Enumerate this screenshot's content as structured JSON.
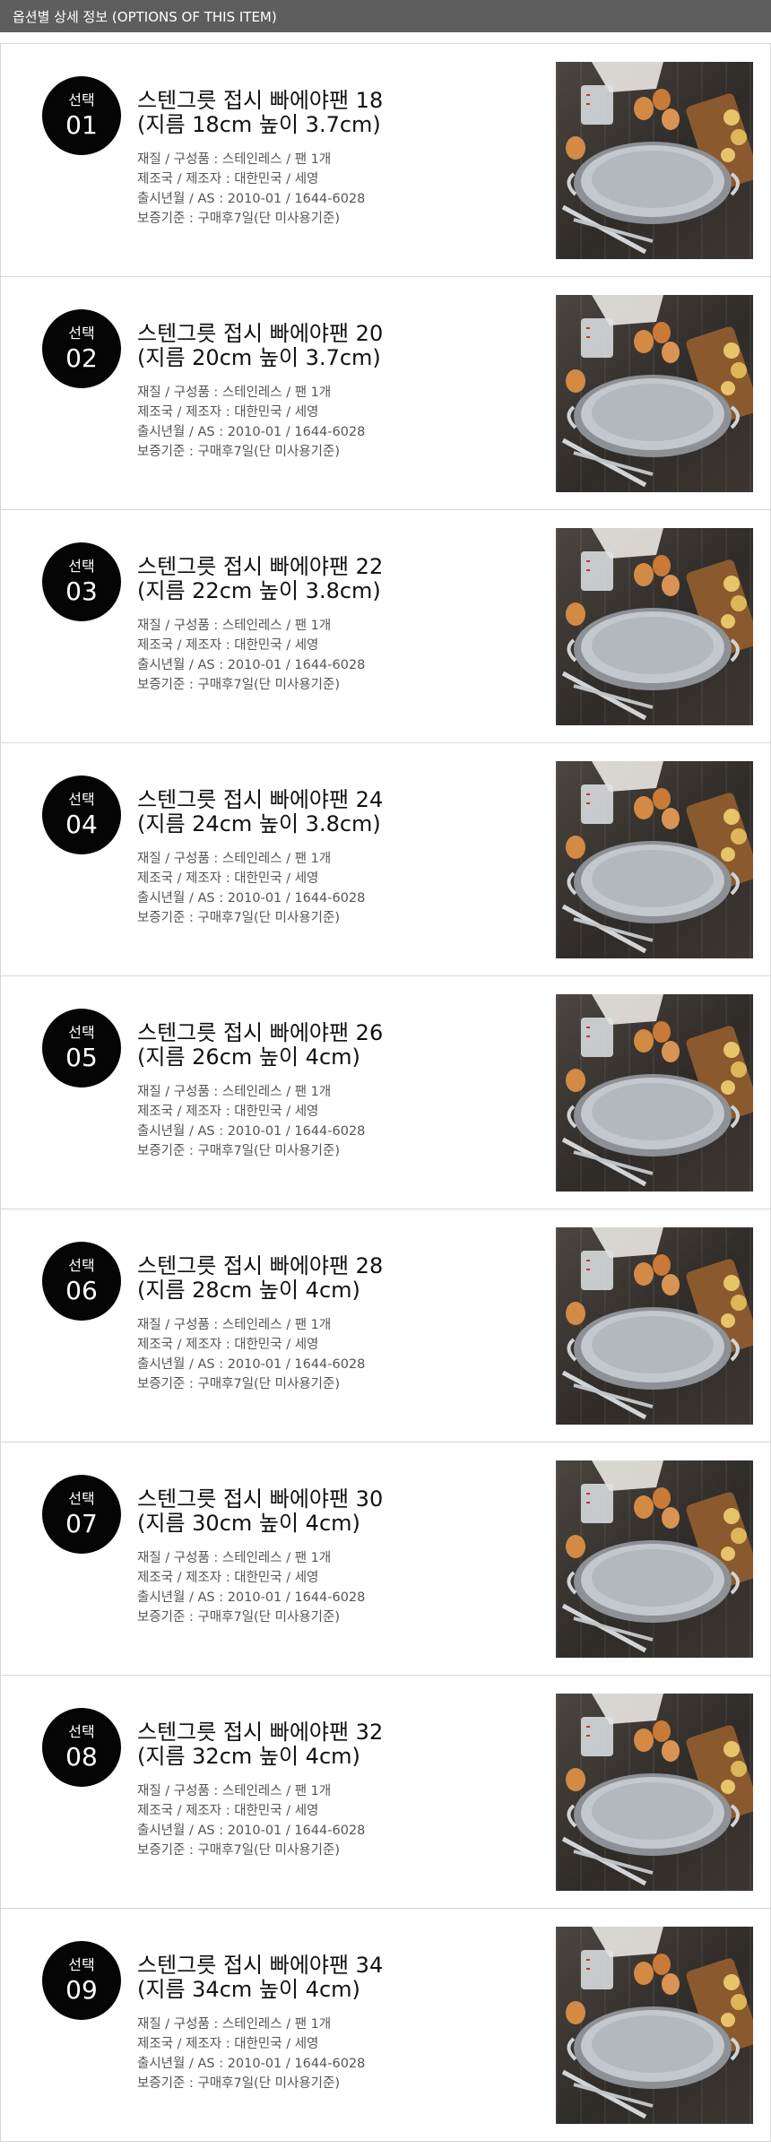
{
  "header": {
    "title": "옵션별 상세 정보 (OPTIONS OF THIS ITEM)"
  },
  "options": [
    {
      "badge_label": "선택",
      "number": "01",
      "title_line1": "스텐그릇 접시 빠에야팬 18",
      "title_line2": "(지름 18cm 높이 3.7cm)",
      "spec1": "재질 / 구성품 : 스테인레스 / 팬 1개",
      "spec2": "제조국 / 제조자 : 대한민국 / 세영",
      "spec3": "출시년월 / AS : 2010-01 / 1644-6028",
      "spec4": "보증기준 : 구매후7일(단 미사용기준)"
    },
    {
      "badge_label": "선택",
      "number": "02",
      "title_line1": "스텐그릇 접시 빠에야팬 20",
      "title_line2": "(지름 20cm 높이 3.7cm)",
      "spec1": "재질 / 구성품 : 스테인레스 / 팬 1개",
      "spec2": "제조국 / 제조자 : 대한민국 / 세영",
      "spec3": "출시년월 / AS : 2010-01 / 1644-6028",
      "spec4": "보증기준 : 구매후7일(단 미사용기준)"
    },
    {
      "badge_label": "선택",
      "number": "03",
      "title_line1": "스텐그릇 접시 빠에야팬 22",
      "title_line2": "(지름 22cm 높이 3.8cm)",
      "spec1": "재질 / 구성품 : 스테인레스 / 팬 1개",
      "spec2": "제조국 / 제조자 : 대한민국 / 세영",
      "spec3": "출시년월 / AS : 2010-01 / 1644-6028",
      "spec4": "보증기준 : 구매후7일(단 미사용기준)"
    },
    {
      "badge_label": "선택",
      "number": "04",
      "title_line1": "스텐그릇 접시 빠에야팬 24",
      "title_line2": "(지름 24cm 높이 3.8cm)",
      "spec1": "재질 / 구성품 : 스테인레스 / 팬 1개",
      "spec2": "제조국 / 제조자 : 대한민국 / 세영",
      "spec3": "출시년월 / AS : 2010-01 / 1644-6028",
      "spec4": "보증기준 : 구매후7일(단 미사용기준)"
    },
    {
      "badge_label": "선택",
      "number": "05",
      "title_line1": "스텐그릇 접시 빠에야팬 26",
      "title_line2": "(지름 26cm 높이 4cm)",
      "spec1": "재질 / 구성품 : 스테인레스 / 팬 1개",
      "spec2": "제조국 / 제조자 : 대한민국 / 세영",
      "spec3": "출시년월 / AS : 2010-01 / 1644-6028",
      "spec4": "보증기준 : 구매후7일(단 미사용기준)"
    },
    {
      "badge_label": "선택",
      "number": "06",
      "title_line1": "스텐그릇 접시 빠에야팬 28",
      "title_line2": "(지름 28cm 높이 4cm)",
      "spec1": "재질 / 구성품 : 스테인레스 / 팬 1개",
      "spec2": "제조국 / 제조자 : 대한민국 / 세영",
      "spec3": "출시년월 / AS : 2010-01 / 1644-6028",
      "spec4": "보증기준 : 구매후7일(단 미사용기준)"
    },
    {
      "badge_label": "선택",
      "number": "07",
      "title_line1": "스텐그릇 접시 빠에야팬 30",
      "title_line2": "(지름 30cm 높이 4cm)",
      "spec1": "재질 / 구성품 : 스테인레스 / 팬 1개",
      "spec2": "제조국 / 제조자 : 대한민국 / 세영",
      "spec3": "출시년월 / AS : 2010-01 / 1644-6028",
      "spec4": "보증기준 : 구매후7일(단 미사용기준)"
    },
    {
      "badge_label": "선택",
      "number": "08",
      "title_line1": "스텐그릇 접시 빠에야팬 32",
      "title_line2": "(지름 32cm 높이 4cm)",
      "spec1": "재질 / 구성품 : 스테인레스 / 팬 1개",
      "spec2": "제조국 / 제조자 : 대한민국 / 세영",
      "spec3": "출시년월 / AS : 2010-01 / 1644-6028",
      "spec4": "보증기준 : 구매후7일(단 미사용기준)"
    },
    {
      "badge_label": "선택",
      "number": "09",
      "title_line1": "스텐그릇 접시 빠에야팬 34",
      "title_line2": "(지름 34cm 높이 4cm)",
      "spec1": "재질 / 구성품 : 스테인레스 / 팬 1개",
      "spec2": "제조국 / 제조자 : 대한민국 / 세영",
      "spec3": "출시년월 / AS : 2010-01 / 1644-6028",
      "spec4": "보증기준 : 구매후7일(단 미사용기준)"
    }
  ]
}
